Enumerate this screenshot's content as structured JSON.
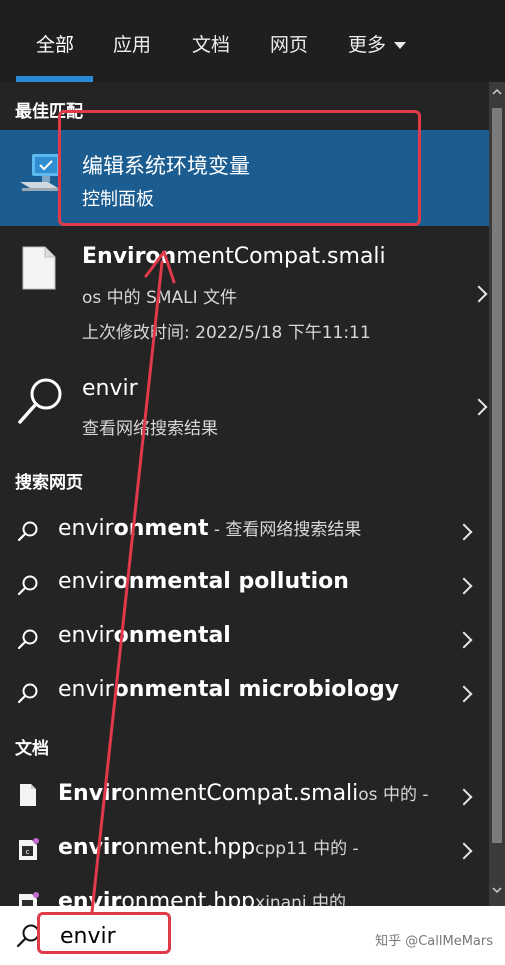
{
  "tabs": [
    "全部",
    "应用",
    "文档",
    "网页",
    "更多"
  ],
  "best_match": {
    "header": "最佳匹配",
    "title": "编辑系统环境变量",
    "subtitle": "控制面板"
  },
  "file_result": {
    "title_bold": "Environ",
    "title_rest": "mentCompat.smali",
    "line1": "os 中的 SMALI 文件",
    "line2": "上次修改时间: 2022/5/18 下午11:11"
  },
  "web_search_result": {
    "title": "envir",
    "subtitle": "查看网络搜索结果"
  },
  "web_section": {
    "header": "搜索网页",
    "items": [
      {
        "prefix": "envir",
        "bold": "onment",
        "suffix": " - 查看网络搜索结果"
      },
      {
        "prefix": "envir",
        "bold": "onmental pollution",
        "suffix": ""
      },
      {
        "prefix": "envir",
        "bold": "onmental",
        "suffix": ""
      },
      {
        "prefix": "envir",
        "bold": "onmental microbiology",
        "suffix": ""
      }
    ]
  },
  "docs_section": {
    "header": "文档",
    "items": [
      {
        "bold": "Envir",
        "rest": "onmentCompat.smali",
        "suffix": "os 中的 -"
      },
      {
        "bold": "envir",
        "rest": "onment.hpp",
        "suffix": "cpp11 中的 -"
      },
      {
        "bold": "envir",
        "rest": "onment.hpp",
        "suffix": "xinani 中的"
      }
    ]
  },
  "search": {
    "value": "envir"
  },
  "watermark": "知乎 @CallMeMars",
  "colors": {
    "accent": "#2b8ad6",
    "selected_bg": "#1c5d91",
    "annotation": "#e0394a"
  }
}
